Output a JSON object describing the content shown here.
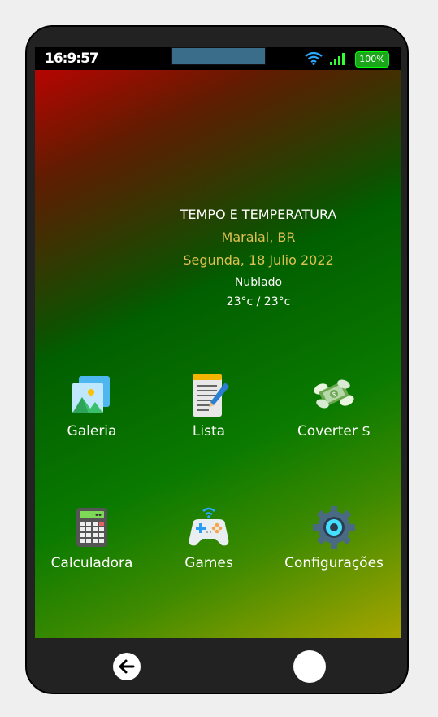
{
  "status": {
    "time": "16:9:57",
    "battery": "100%"
  },
  "weather": {
    "title": "TEMPO E TEMPERATURA",
    "city": "Maraial, BR",
    "date": "Segunda, 18 Julio 2022",
    "condition": "Nublado",
    "temps": "23°c / 23°c"
  },
  "apps": [
    {
      "label": "Galeria",
      "icon": "gallery-icon"
    },
    {
      "label": "Lista",
      "icon": "notepad-icon"
    },
    {
      "label": "Coverter $",
      "icon": "money-icon"
    },
    {
      "label": "Calculadora",
      "icon": "calculator-icon"
    },
    {
      "label": "Games",
      "icon": "gamepad-icon"
    },
    {
      "label": "Configurações",
      "icon": "settings-gear-icon"
    }
  ],
  "colors": {
    "screen_red": "#c80000",
    "screen_green": "#008000",
    "screen_yellow": "#a7a500",
    "weather_accent": "#e0c050",
    "battery": "#1aa51a"
  }
}
